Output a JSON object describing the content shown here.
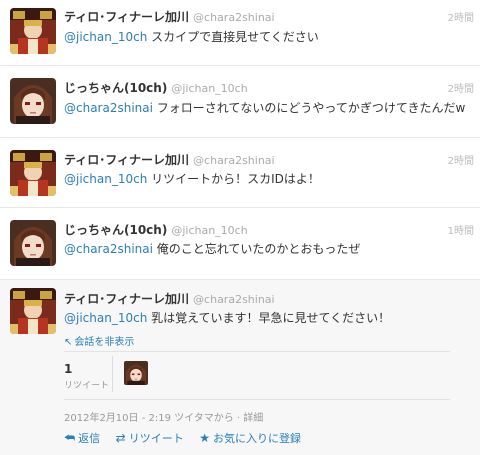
{
  "tweets": [
    {
      "name": "ティロ･フィナーレ加川",
      "handle": "@chara2shinai",
      "time": "2時間",
      "mention": "@jichan_10ch",
      "text": " スカイプで直接見せてください",
      "avatar": "avatar-a"
    },
    {
      "name": "じっちゃん(10ch)",
      "handle": "@jichan_10ch",
      "time": "2時間",
      "mention": "@chara2shinai",
      "text": " フォローされてないのにどうやってかぎつけてきたんだw",
      "avatar": "avatar-b"
    },
    {
      "name": "ティロ･フィナーレ加川",
      "handle": "@chara2shinai",
      "time": "2時間",
      "mention": "@jichan_10ch",
      "text": " リツイートから！スカIDはよ！",
      "avatar": "avatar-a"
    },
    {
      "name": "じっちゃん(10ch)",
      "handle": "@jichan_10ch",
      "time": "1時間",
      "mention": "@chara2shinai",
      "text": " 俺のこと忘れていたのかとおもったぜ",
      "avatar": "avatar-b"
    }
  ],
  "focused": {
    "name": "ティロ･フィナーレ加川",
    "handle": "@chara2shinai",
    "mention": "@jichan_10ch",
    "text": " 乳は覚えています！早急に見せてください！",
    "hide_conversation": "会話を非表示",
    "retweet_count": "1",
    "retweet_label": "リツイート",
    "meta": "2012年2月10日 - 2:19 ツイタマから · 詳細",
    "actions": {
      "reply": "返信",
      "retweet": "リツイート",
      "favorite": "お気に入りに登録"
    }
  },
  "colors": {
    "link": "#2a7fba",
    "muted": "#999999"
  }
}
